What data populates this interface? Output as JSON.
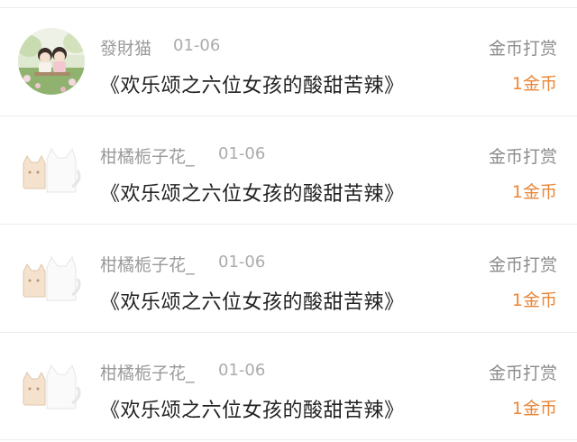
{
  "tips": [
    {
      "user": "發財猫",
      "date": "01-06",
      "book": "《欢乐颂之六位女孩的酸甜苦辣》",
      "reward_type": "金币打赏",
      "amount": "1金币",
      "avatar_icon": "couple-photo-avatar-icon"
    },
    {
      "user": "柑橘栀子花_",
      "date": "01-06",
      "book": "《欢乐颂之六位女孩的酸甜苦辣》",
      "reward_type": "金币打赏",
      "amount": "1金币",
      "avatar_icon": "cartoon-cats-avatar-icon"
    },
    {
      "user": "柑橘栀子花_",
      "date": "01-06",
      "book": "《欢乐颂之六位女孩的酸甜苦辣》",
      "reward_type": "金币打赏",
      "amount": "1金币",
      "avatar_icon": "cartoon-cats-avatar-icon"
    },
    {
      "user": "柑橘栀子花_",
      "date": "01-06",
      "book": "《欢乐颂之六位女孩的酸甜苦辣》",
      "reward_type": "金币打赏",
      "amount": "1金币",
      "avatar_icon": "cartoon-cats-avatar-icon"
    }
  ],
  "colors": {
    "username": "#9a9a9a",
    "title": "#222222",
    "reward_amount": "#e8873a",
    "divider": "#ededed"
  }
}
